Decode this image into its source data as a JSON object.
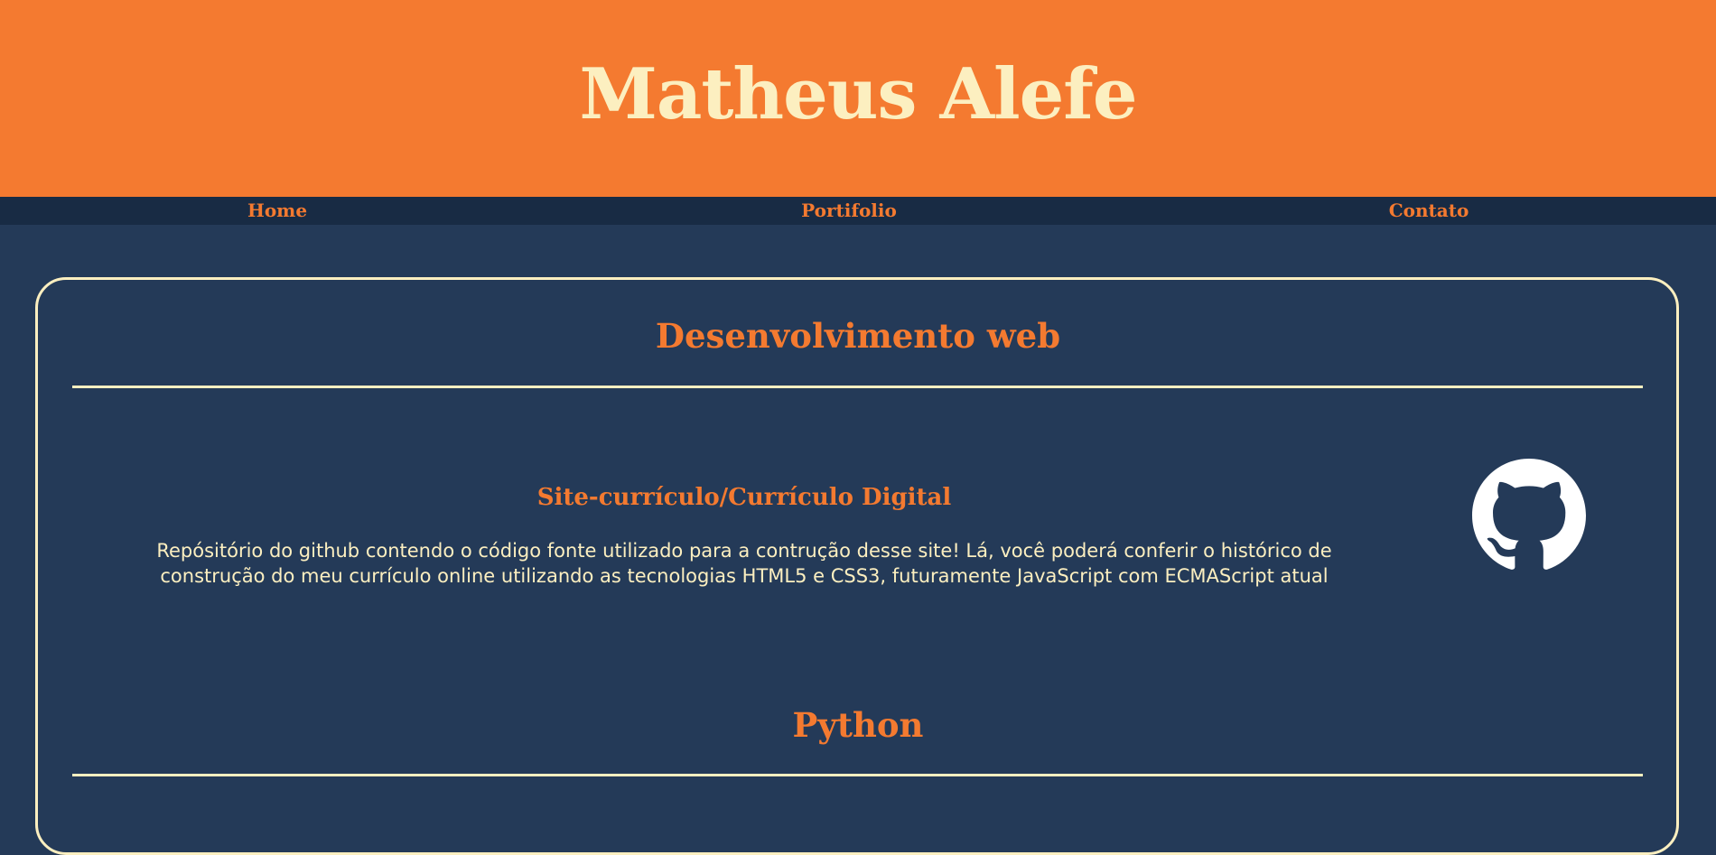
{
  "header": {
    "title": "Matheus Alefe"
  },
  "nav": {
    "home": "Home",
    "portfolio": "Portifolio",
    "contact": "Contato"
  },
  "sections": {
    "web": {
      "title": "Desenvolvimento web",
      "project": {
        "title": "Site-currículo/Currículo Digital",
        "description": "Repósitório do github contendo o código fonte utilizado para a contrução desse site! Lá, você poderá conferir o histórico de construção do meu currículo online utilizando as tecnologias HTML5 e CSS3, futuramente JavaScript com ECMAScript atual",
        "icon": "github-icon"
      }
    },
    "python": {
      "title": "Python"
    }
  },
  "colors": {
    "accent": "#f47a30",
    "cream": "#fcefc0",
    "background": "#243a58",
    "nav_background": "#182b44"
  }
}
